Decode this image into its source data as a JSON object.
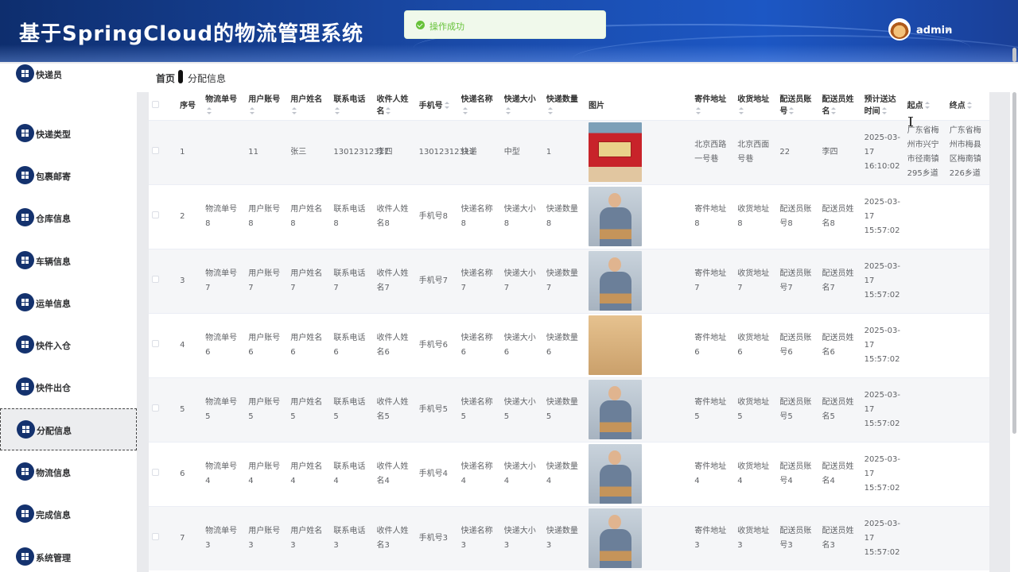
{
  "header": {
    "title": "基于SpringCloud的物流管理系统",
    "user": "admin"
  },
  "toast": {
    "message": "操作成功"
  },
  "breadcrumb": {
    "home": "首页",
    "current": "分配信息"
  },
  "sidebar": {
    "items": [
      {
        "label": "快递员"
      },
      {
        "label": "快递类型"
      },
      {
        "label": "包裹邮寄"
      },
      {
        "label": "仓库信息"
      },
      {
        "label": "车辆信息"
      },
      {
        "label": "运单信息"
      },
      {
        "label": "快件入仓"
      },
      {
        "label": "快件出仓"
      },
      {
        "label": "分配信息"
      },
      {
        "label": "物流信息"
      },
      {
        "label": "完成信息"
      },
      {
        "label": "系统管理"
      }
    ]
  },
  "table": {
    "headers": [
      "序号",
      "物流单号",
      "用户账号",
      "用户姓名",
      "联系电话",
      "收件人姓名",
      "手机号",
      "快递名称",
      "快递大小",
      "快递数量",
      "图片",
      "寄件地址",
      "收货地址",
      "配送员账号",
      "配送员姓名",
      "预计送达时间",
      "起点",
      "终点"
    ],
    "rows": [
      {
        "idx": "1",
        "waybill": "",
        "account": "11",
        "name": "张三",
        "phone": "13012312311",
        "recv": "李四",
        "mobile": "13012312311",
        "pname": "快递",
        "size": "中型",
        "qty": "1",
        "img": "box",
        "send": "北京西路一号巷",
        "addr": "北京西面号巷",
        "cacct": "22",
        "cname": "李四",
        "eta": "2025-03-17 16:10:02",
        "start": "广东省梅州市兴宁市径南镇295乡道",
        "end": "广东省梅州市梅县区梅南镇226乡道"
      },
      {
        "idx": "2",
        "waybill": "物流单号8",
        "account": "用户账号8",
        "name": "用户姓名8",
        "phone": "联系电话8",
        "recv": "收件人姓名8",
        "mobile": "手机号8",
        "pname": "快递名称8",
        "size": "快递大小8",
        "qty": "快递数量8",
        "img": "man",
        "send": "寄件地址8",
        "addr": "收货地址8",
        "cacct": "配送员账号8",
        "cname": "配送员姓名8",
        "eta": "2025-03-17 15:57:02",
        "start": "",
        "end": ""
      },
      {
        "idx": "3",
        "waybill": "物流单号7",
        "account": "用户账号7",
        "name": "用户姓名7",
        "phone": "联系电话7",
        "recv": "收件人姓名7",
        "mobile": "手机号7",
        "pname": "快递名称7",
        "size": "快递大小7",
        "qty": "快递数量7",
        "img": "man",
        "send": "寄件地址7",
        "addr": "收货地址7",
        "cacct": "配送员账号7",
        "cname": "配送员姓名7",
        "eta": "2025-03-17 15:57:02",
        "start": "",
        "end": ""
      },
      {
        "idx": "4",
        "waybill": "物流单号6",
        "account": "用户账号6",
        "name": "用户姓名6",
        "phone": "联系电话6",
        "recv": "收件人姓名6",
        "mobile": "手机号6",
        "pname": "快递名称6",
        "size": "快递大小6",
        "qty": "快递数量6",
        "img": "warm",
        "send": "寄件地址6",
        "addr": "收货地址6",
        "cacct": "配送员账号6",
        "cname": "配送员姓名6",
        "eta": "2025-03-17 15:57:02",
        "start": "",
        "end": ""
      },
      {
        "idx": "5",
        "waybill": "物流单号5",
        "account": "用户账号5",
        "name": "用户姓名5",
        "phone": "联系电话5",
        "recv": "收件人姓名5",
        "mobile": "手机号5",
        "pname": "快递名称5",
        "size": "快递大小5",
        "qty": "快递数量5",
        "img": "man",
        "send": "寄件地址5",
        "addr": "收货地址5",
        "cacct": "配送员账号5",
        "cname": "配送员姓名5",
        "eta": "2025-03-17 15:57:02",
        "start": "",
        "end": ""
      },
      {
        "idx": "6",
        "waybill": "物流单号4",
        "account": "用户账号4",
        "name": "用户姓名4",
        "phone": "联系电话4",
        "recv": "收件人姓名4",
        "mobile": "手机号4",
        "pname": "快递名称4",
        "size": "快递大小4",
        "qty": "快递数量4",
        "img": "man",
        "send": "寄件地址4",
        "addr": "收货地址4",
        "cacct": "配送员账号4",
        "cname": "配送员姓名4",
        "eta": "2025-03-17 15:57:02",
        "start": "",
        "end": ""
      },
      {
        "idx": "7",
        "waybill": "物流单号3",
        "account": "用户账号3",
        "name": "用户姓名3",
        "phone": "联系电话3",
        "recv": "收件人姓名3",
        "mobile": "手机号3",
        "pname": "快递名称3",
        "size": "快递大小3",
        "qty": "快递数量3",
        "img": "man",
        "send": "寄件地址3",
        "addr": "收货地址3",
        "cacct": "配送员账号3",
        "cname": "配送员姓名3",
        "eta": "2025-03-17 15:57:02",
        "start": "",
        "end": ""
      }
    ]
  },
  "colors": {
    "header_start": "#0e2e6e",
    "header_end": "#1c57c4",
    "icon": "#14326e",
    "success": "#67c23a"
  }
}
